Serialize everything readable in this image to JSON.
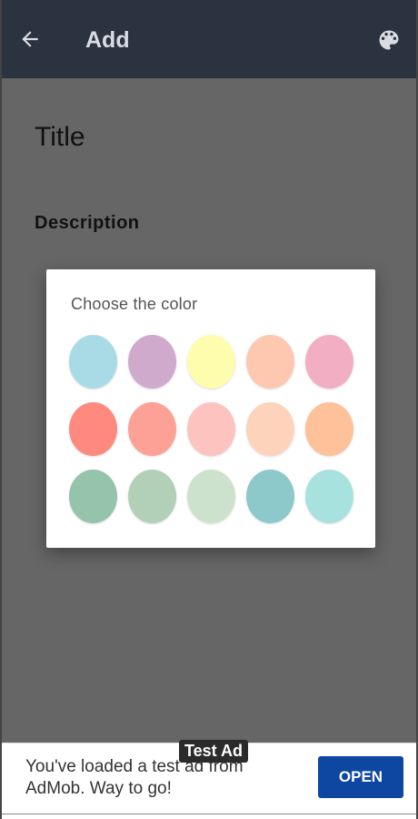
{
  "app_bar": {
    "title": "Add",
    "back_icon": "arrow-left-icon",
    "palette_icon": "palette-icon",
    "background": "#2b3240"
  },
  "form": {
    "title_placeholder": "Title",
    "description_placeholder": "Description"
  },
  "color_dialog": {
    "title": "Choose the color",
    "colors": [
      "#a9dbe6",
      "#cfaacd",
      "#fefdae",
      "#fdc7b0",
      "#f2aec3",
      "#fe8a7f",
      "#fda196",
      "#fdc3bf",
      "#fed3bc",
      "#fec19a",
      "#96c3ab",
      "#b2d0b8",
      "#cde2cd",
      "#8dc9cb",
      "#a7e2de"
    ]
  },
  "ad": {
    "text": "You've loaded a test ad from AdMob. Way to go!",
    "open_label": "OPEN",
    "badge": "Test Ad",
    "button_color": "#0d47a1"
  }
}
